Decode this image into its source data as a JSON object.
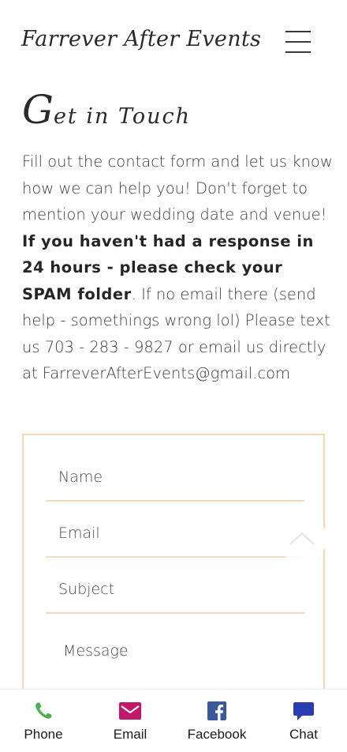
{
  "header": {
    "brand": "Farrever After Events",
    "menu_icon": "hamburger-menu-icon"
  },
  "page": {
    "title_cap": "G",
    "title_rest": "et in Touch",
    "intro_1": "Fill out the contact form and let us know how we can help you! Don't forget to mention your wedding date and venue! ",
    "intro_bold": "If you haven't had a response in 24 hours - please check your SPAM folder",
    "intro_2": ". If no email there (send help - somethings wrong lol) Please text us 703 - 283 - 9827 or email us directly at FarreverAfterEvents@gmail.com"
  },
  "form": {
    "name_placeholder": "Name",
    "email_placeholder": "Email",
    "subject_placeholder": "Subject",
    "message_placeholder": "Message",
    "border_color": "#f6d9b2"
  },
  "scroll_top_icon": "chevron-up-icon",
  "bottom_bar": {
    "items": [
      {
        "label": "Phone",
        "icon": "phone-icon",
        "color": "#4caf50"
      },
      {
        "label": "Email",
        "icon": "envelope-icon",
        "color": "#c2186b"
      },
      {
        "label": "Facebook",
        "icon": "facebook-icon",
        "color": "#3b5998"
      },
      {
        "label": "Chat",
        "icon": "chat-icon",
        "color": "#2a3eb1"
      }
    ]
  }
}
